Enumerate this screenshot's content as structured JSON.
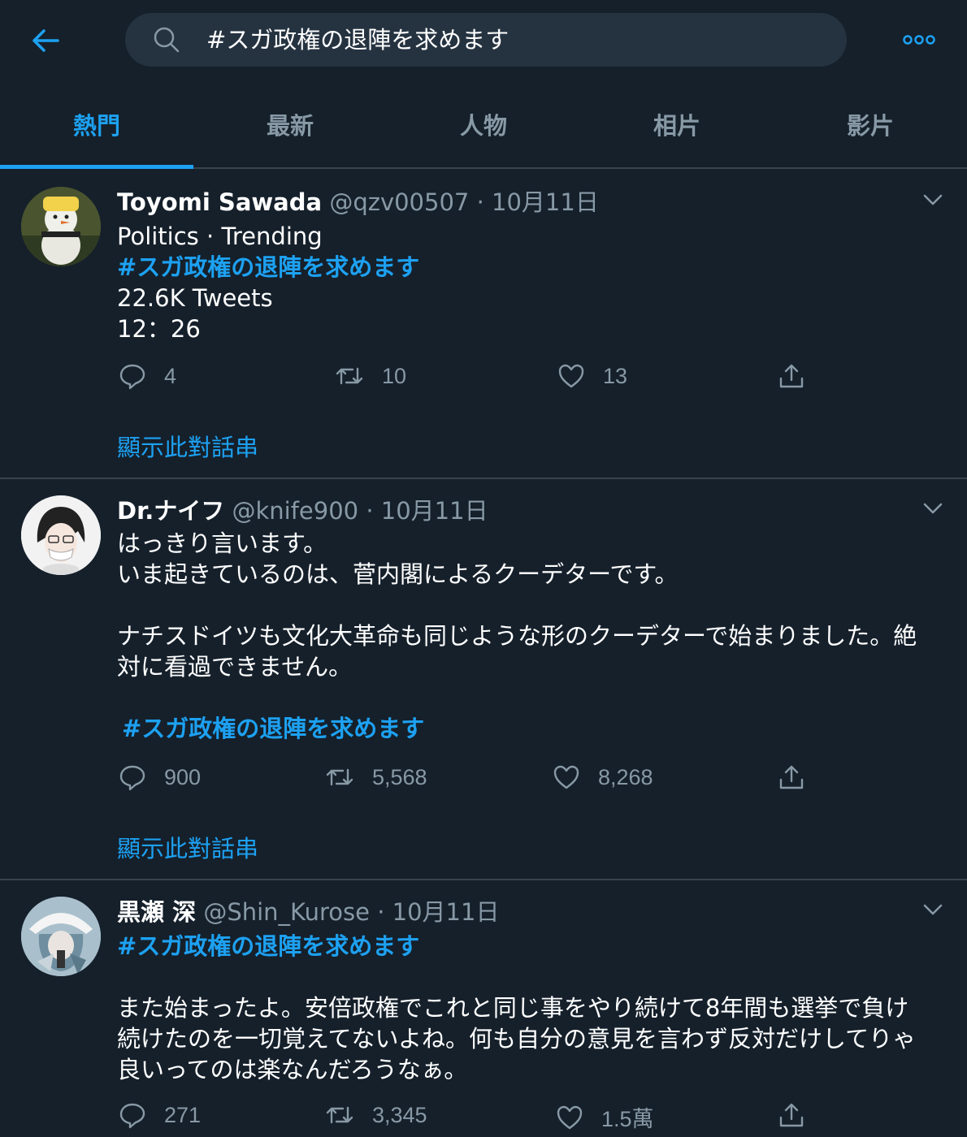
{
  "search": {
    "query": "#スガ政権の退陣を求めます"
  },
  "tabs": [
    {
      "label": "熱門"
    },
    {
      "label": "最新"
    },
    {
      "label": "人物"
    },
    {
      "label": "相片"
    },
    {
      "label": "影片"
    }
  ],
  "colors": {
    "background": "#15202b",
    "accent": "#1da1f2",
    "muted": "#8899a6",
    "divider": "#38444d",
    "searchbox": "#253341"
  },
  "icons": [
    "back-arrow-icon",
    "search-icon",
    "more-icon",
    "chevron-down-icon",
    "reply-icon",
    "retweet-icon",
    "like-icon",
    "share-icon"
  ],
  "tweets": [
    {
      "name": "Toyomi Sawada",
      "handle": "@qzv00507",
      "date": "· 10月11日",
      "lines": [
        "Politics · Trending"
      ],
      "hashtag": "#スガ政権の退陣を求めます",
      "extra_lines": [
        "22.6K Tweets",
        "12：26"
      ],
      "replies": "4",
      "retweets": "10",
      "likes": "13",
      "thread_label": "顯示此對話串"
    },
    {
      "name": "Dr.ナイフ",
      "handle": "@knife900",
      "date": "· 10月11日",
      "lines": [
        "はっきり言います。",
        "いま起きているのは、菅内閣によるクーデターです。",
        "ナチスドイツも文化大革命も同じような形のクーデターで始まりました。絶",
        "対に看過できません。"
      ],
      "hashtag": "#スガ政権の退陣を求めます",
      "replies": "900",
      "retweets": "5,568",
      "likes": "8,268",
      "thread_label": "顯示此對話串"
    },
    {
      "name": "黒瀬 深",
      "handle": "@Shin_Kurose",
      "date": "· 10月11日",
      "hashtag": "#スガ政権の退陣を求めます",
      "lines": [
        "また始まったよ。安倍政権でこれと同じ事をやり続けて8年間も選挙で負け",
        "続けたのを一切覚えてないよね。何も自分の意見を言わず反対だけしてりゃ",
        "良いってのは楽なんだろうなぁ。"
      ],
      "replies": "271",
      "retweets": "3,345",
      "likes": "1.5萬"
    }
  ]
}
